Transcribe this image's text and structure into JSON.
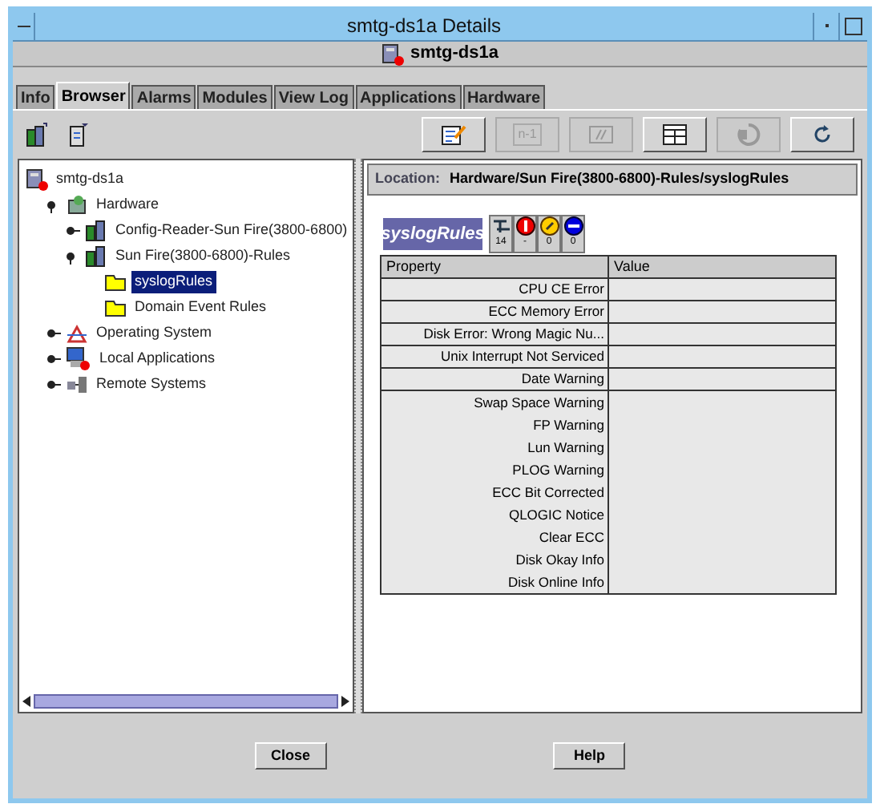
{
  "window": {
    "title": "smtg-ds1a Details",
    "subtitle": "smtg-ds1a"
  },
  "tabs": [
    {
      "label": "Info",
      "selected": false
    },
    {
      "label": "Browser",
      "selected": true
    },
    {
      "label": "Alarms",
      "selected": false
    },
    {
      "label": "Modules",
      "selected": false
    },
    {
      "label": "View Log",
      "selected": false
    },
    {
      "label": "Applications",
      "selected": false
    },
    {
      "label": "Hardware",
      "selected": false
    }
  ],
  "toolbar": [
    {
      "kind": "edit",
      "disabled": false
    },
    {
      "kind": "step",
      "label": "n-1",
      "disabled": true
    },
    {
      "kind": "code",
      "disabled": true
    },
    {
      "kind": "table",
      "disabled": false
    },
    {
      "kind": "sync",
      "disabled": true
    },
    {
      "kind": "refresh",
      "disabled": false
    }
  ],
  "tree": [
    {
      "label": "smtg-ds1a",
      "kind": "host",
      "children": [
        {
          "label": "Hardware",
          "kind": "hardware",
          "expanded": true,
          "children": [
            {
              "label": "Config-Reader-Sun Fire(3800-6800)",
              "kind": "module",
              "expanded": false
            },
            {
              "label": "Sun Fire(3800-6800)-Rules",
              "kind": "module",
              "expanded": true,
              "children": [
                {
                  "label": "syslogRules",
                  "kind": "folder",
                  "selected": true
                },
                {
                  "label": "Domain Event Rules",
                  "kind": "folder",
                  "selected": false
                }
              ]
            }
          ]
        },
        {
          "label": "Operating System",
          "kind": "os",
          "expanded": false
        },
        {
          "label": "Local Applications",
          "kind": "apps",
          "expanded": false
        },
        {
          "label": "Remote Systems",
          "kind": "remote",
          "expanded": false
        }
      ]
    }
  ],
  "location": {
    "label": "Location:",
    "path": "Hardware/Sun Fire(3800-6800)-Rules/syslogRules"
  },
  "object": {
    "name": "syslogRules",
    "alarms": [
      {
        "kind": "info",
        "count": "14"
      },
      {
        "kind": "critical",
        "count": "-"
      },
      {
        "kind": "minor",
        "count": "0"
      },
      {
        "kind": "down",
        "count": "0"
      }
    ]
  },
  "table": {
    "columns": [
      "Property",
      "Value"
    ],
    "rows": [
      {
        "property": "CPU CE Error",
        "kind": "boxed"
      },
      {
        "property": "ECC Memory Error",
        "kind": "boxed"
      },
      {
        "property": "Disk Error: Wrong Magic Nu...",
        "kind": "boxed"
      },
      {
        "property": "Unix Interrupt Not Serviced",
        "kind": "boxed"
      },
      {
        "property": "Date Warning",
        "kind": "boxed"
      },
      {
        "property": "Swap Space Warning",
        "kind": "plain"
      },
      {
        "property": "FP Warning",
        "kind": "plain"
      },
      {
        "property": "Lun Warning",
        "kind": "plain"
      },
      {
        "property": "PLOG Warning",
        "kind": "plain"
      },
      {
        "property": "ECC Bit Corrected",
        "kind": "plain"
      },
      {
        "property": "QLOGIC Notice",
        "kind": "plain"
      },
      {
        "property": "Clear ECC",
        "kind": "plain"
      },
      {
        "property": "Disk Okay Info",
        "kind": "plain"
      },
      {
        "property": "Disk Online Info",
        "kind": "plain"
      }
    ]
  },
  "buttons": [
    "Close",
    "Help"
  ]
}
